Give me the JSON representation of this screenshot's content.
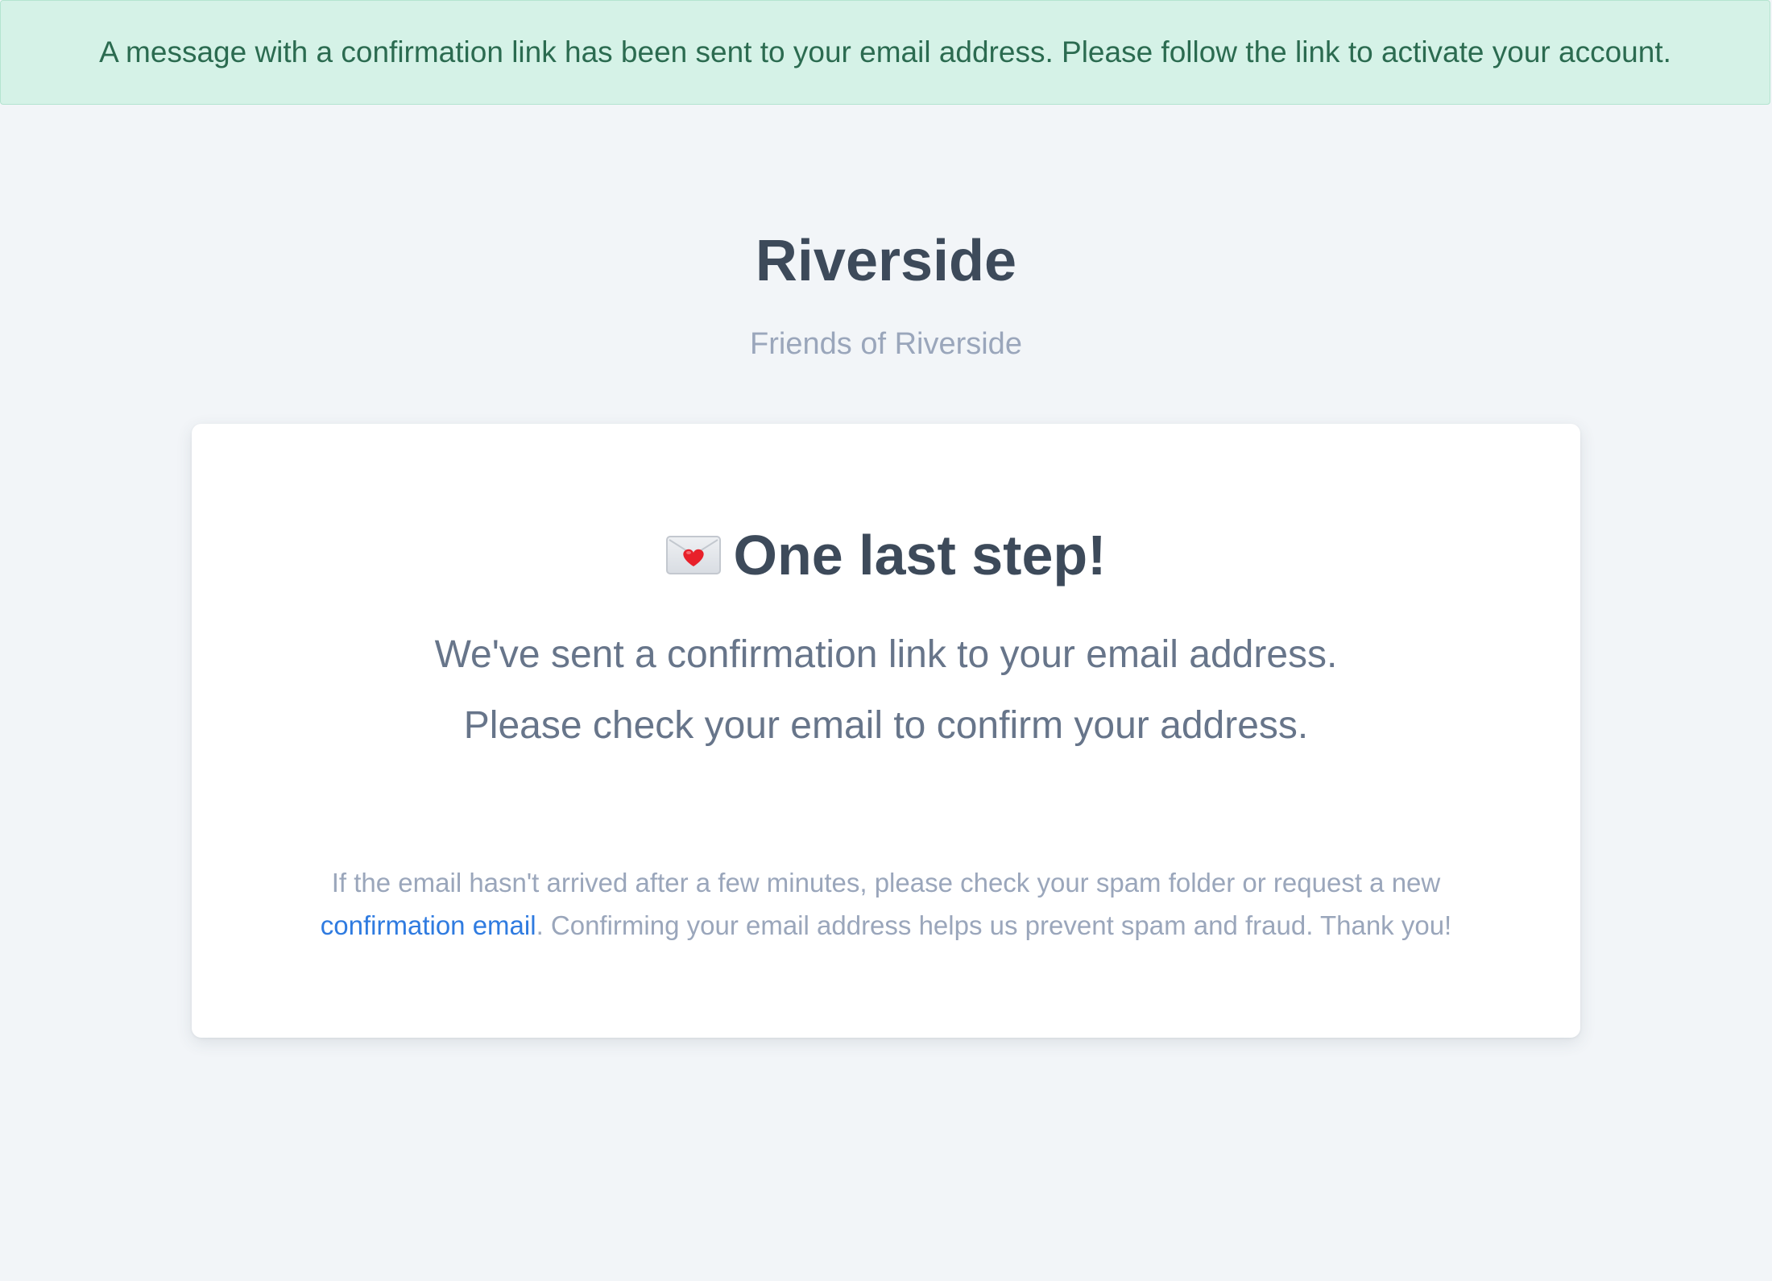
{
  "flash": {
    "message": "A message with a confirmation link has been sent to your email address. Please follow the link to activate your account."
  },
  "header": {
    "title": "Riverside",
    "subtitle": "Friends of Riverside"
  },
  "card": {
    "icon": "love-letter-icon",
    "headline": "One last step!",
    "line1": "We've sent a confirmation link to your email address.",
    "line2": "Please check your email to confirm your address.",
    "note_prefix": "If the email hasn't arrived after a few minutes, please check your spam folder or request a new",
    "note_link": "confirmation email",
    "note_suffix": ". Confirming your email address helps us prevent spam and fraud. Thank you!"
  },
  "colors": {
    "background": "#f2f5f8",
    "flash_bg": "#d5f2e7",
    "flash_text": "#2b6b50",
    "heading": "#3d4a5a",
    "body_text": "#67758a",
    "muted": "#9aa6bb",
    "link": "#2f7be0"
  }
}
